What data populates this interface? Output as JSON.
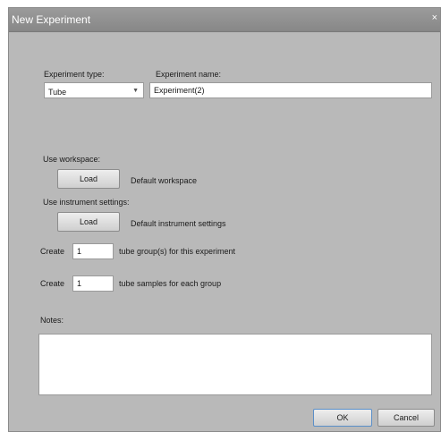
{
  "window": {
    "title": "New Experiment",
    "close_glyph": "×"
  },
  "form": {
    "experiment_type_label": "Experiment type:",
    "experiment_type_value": "Tube",
    "experiment_name_label": "Experiment name:",
    "experiment_name_value": "Experiment(2)",
    "use_workspace_label": "Use workspace:",
    "workspace_load_label": "Load",
    "workspace_default_text": "Default workspace",
    "use_instrument_label": "Use instrument settings:",
    "instrument_load_label": "Load",
    "instrument_default_text": "Default instrument settings",
    "create_label_1": "Create",
    "tube_groups_value": "1",
    "tube_groups_suffix": "tube group(s) for this experiment",
    "create_label_2": "Create",
    "tube_samples_value": "1",
    "tube_samples_suffix": "tube samples for each group",
    "notes_label": "Notes:",
    "notes_value": ""
  },
  "footer": {
    "ok_label": "OK",
    "cancel_label": "Cancel"
  },
  "icons": {
    "select_arrow": "dropdown-arrow-icon",
    "close": "close-icon"
  },
  "colors": {
    "dialog_bg": "#b9b9b9",
    "titlebar": "#8f8f8f",
    "ok_border": "#5b8fc8"
  }
}
